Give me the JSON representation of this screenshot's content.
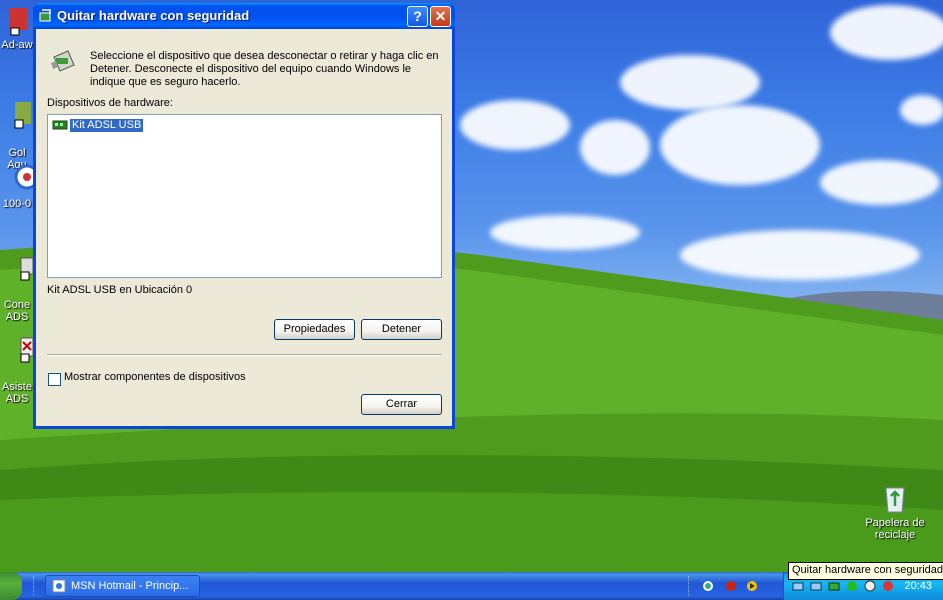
{
  "desktop": {
    "icons": [
      {
        "label": "Ad-aw"
      },
      {
        "label": "Gol\nAqu"
      },
      {
        "label": "100-0"
      },
      {
        "label": "Cone\nADS"
      },
      {
        "label": "Asiste\nADS"
      }
    ],
    "recycle_bin_label": "Papelera de reciclaje"
  },
  "dialog": {
    "title": "Quitar hardware con seguridad",
    "help_glyph": "?",
    "close_glyph": "✕",
    "intro": "Seleccione el dispositivo que desea desconectar o retirar y haga clic en Detener. Desconecte el dispositivo del equipo cuando Windows le indique que es seguro hacerlo.",
    "devices_label": "Dispositivos de hardware:",
    "devices": [
      "Kit ADSL USB"
    ],
    "status": "Kit ADSL USB en Ubicación 0",
    "properties_button": "Propiedades",
    "stop_button": "Detener",
    "show_components_label": "Mostrar componentes de dispositivos",
    "close_button": "Cerrar"
  },
  "taskbar": {
    "task": "MSN Hotmail - Princip...",
    "clock": "20:43",
    "tooltip": "Quitar hardware con seguridad"
  },
  "icons": {
    "title": "safely-remove-hardware-icon",
    "device": "usb-device-icon",
    "task": "msn-icon"
  }
}
